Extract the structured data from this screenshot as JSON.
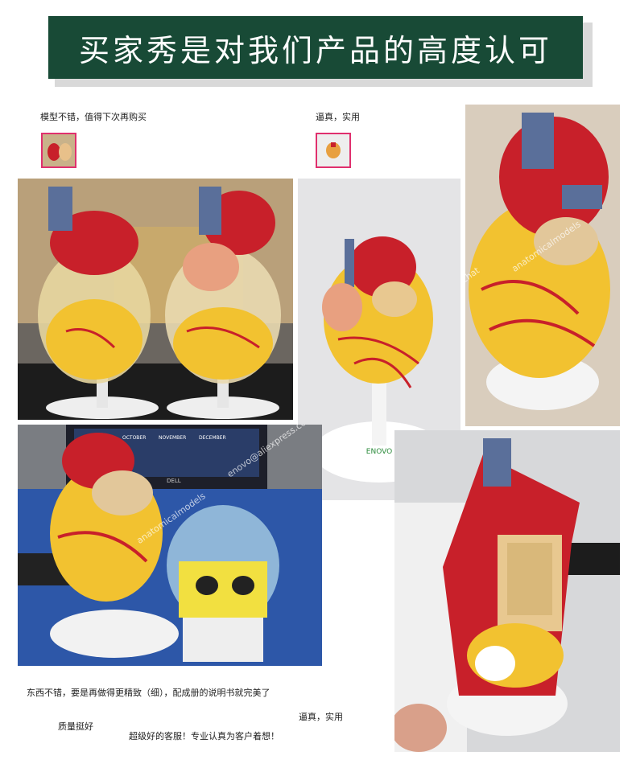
{
  "banner": {
    "title": "买家秀是对我们产品的高度认可"
  },
  "reviews": {
    "review1": "模型不错，值得下次再购买",
    "review2": "逼真，实用",
    "review3": "东西不错，要是再做得更精致（细），配成册的说明书就完美了",
    "review4": "逼真，实用",
    "review5": "质量挺好",
    "review6": "超级好的客服！专业认真为客户着想！"
  },
  "watermark": {
    "site1": "wechat",
    "site2": "anatomicalmodels",
    "site3": "enovo@aliexpress.com"
  },
  "logo": "ENOVO",
  "monitor_brand": "DELL",
  "calendar": {
    "m1": "OCTOBER",
    "m2": "NOVEMBER",
    "m3": "DECEMBER"
  },
  "colors": {
    "banner": "#184a36",
    "thumb_border": "#e0306e",
    "heart_red": "#c8202a",
    "heart_yellow": "#f2c230",
    "vessel_blue": "#5a6f9a"
  }
}
